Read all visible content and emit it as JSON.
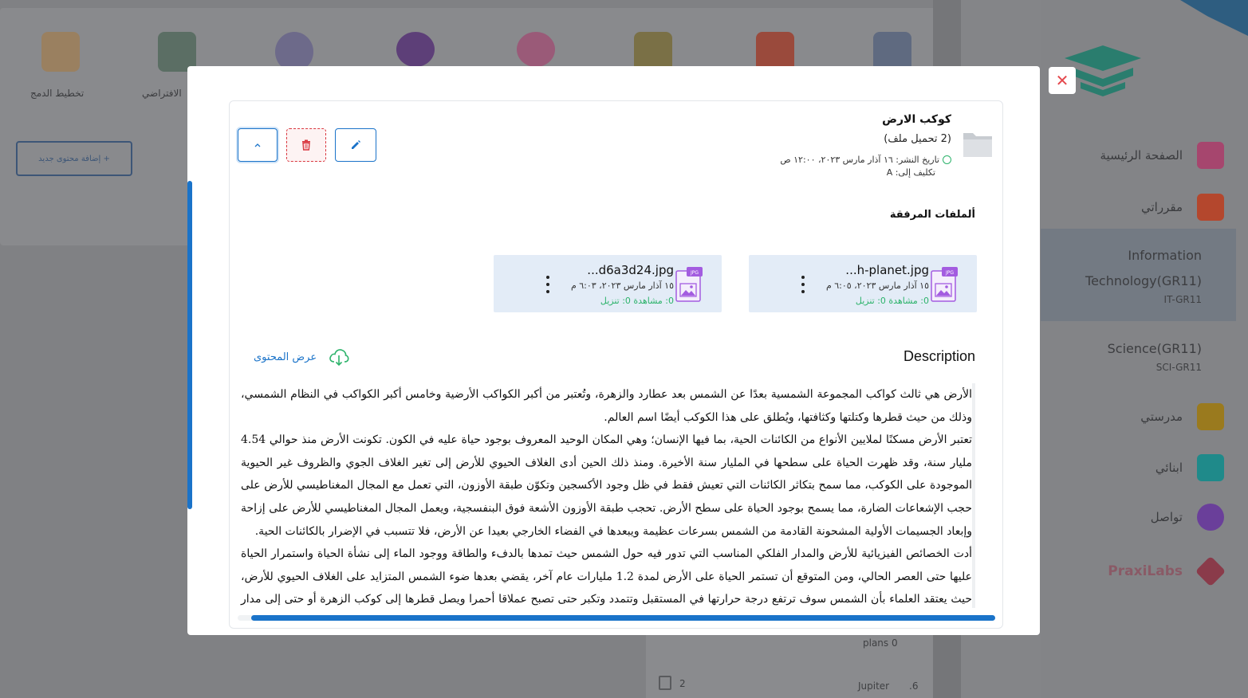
{
  "background": {
    "top_labels": [
      "تخطيط الدمج",
      "الافتراضي"
    ],
    "add_button": "+ إضافة محتوى جديد",
    "sidebar": {
      "items": [
        {
          "label": "الصفحة الرئيسية",
          "color": "#a6466e"
        },
        {
          "label": "مقرراتي",
          "color": "#b4472d"
        }
      ],
      "classes": [
        {
          "name": "Information Technology(GR11)",
          "code": "IT-GR11"
        },
        {
          "name": "Science(GR11)",
          "code": "SCI-GR11"
        }
      ],
      "more_items": [
        {
          "label": "مدرستي",
          "color": "#9a7a1e"
        },
        {
          "label": "ابنائي",
          "color": "#1f8a8a"
        },
        {
          "label": "تواصل",
          "color": "#6a3f9a"
        }
      ],
      "brand": "PraxiLabs"
    },
    "rows": {
      "row1": "plans 0",
      "row2_count": "2",
      "row2_name": "Jupiter",
      "row2_num": ".6"
    }
  },
  "modal": {
    "close_label": "✕",
    "lesson": {
      "title": "كوكب الارض",
      "subtitle": "(2 تحميل ملف)",
      "published": "تاريخ النشر: ١٦ آذار مارس ٢٠٢٣، ١٢:٠٠ ص",
      "assigned": "تكليف إلى: A"
    },
    "actions": {
      "edit": "edit",
      "delete": "delete",
      "collapse": "collapse"
    },
    "attachments_title": "ألملفات المرفقة",
    "files": [
      {
        "name": "...h-planet.jpg",
        "date": "١٥ آذار مارس ٢٠٢٣، ٦:٠٥ م",
        "stats": "0: مشاهدة 0: تنزيل"
      },
      {
        "name": "...d6a3d24.jpg",
        "date": "١٥ آذار مارس ٢٠٢٣، ٦:٠٣ م",
        "stats": "0: مشاهدة 0: تنزيل"
      }
    ],
    "description_title": "Description",
    "view_content": "عرض المحتوى",
    "description_paragraphs": [
      "الأرض هي ثالث كواكب المجموعة الشمسية بعدًا عن الشمس بعد عطارد والزهرة، وتُعتبر من أكبر الكواكب الأرضية وخامس أكبر الكواكب في النظام الشمسي، وذلك من حيث قطرها وكتلتها وكثافتها، ويُطلق على هذا الكوكب أيضًا اسم العالم.",
      "تعتبر الأرض مسكنًا لملايين الأنواع من الكائنات الحية، بما فيها الإنسان؛ وهي المكان الوحيد المعروف بوجود حياة عليه في الكون. تكونت الأرض منذ حوالي 4.54 مليار سنة، وقد ظهرت الحياة على سطحها في المليار سنة الأخيرة. ومنذ ذلك الحين أدى الغلاف الحيوي للأرض إلى تغير الغلاف الجوي والظروف غير الحيوية الموجودة على الكوكب، مما سمح بتكاثر الكائنات التي تعيش فقط في ظل وجود الأكسجين وتكوّن طبقة الأوزون، التي تعمل مع المجال المغناطيسي للأرض على حجب الإشعاعات الضارة، مما يسمح بوجود الحياة على سطح الأرض. تحجب طبقة الأوزون الأشعة فوق البنفسجية، ويعمل المجال المغناطيسي للأرض على إزاحة وإبعاد الجسيمات الأولية المشحونة القادمة من الشمس بسرعات عظيمة ويبعدها في الفضاء الخارجي بعيدا عن الأرض، فلا تتسبب في الإضرار بالكائنات الحية.",
      "أدت الخصائص الفيزيائية للأرض والمدار الفلكي المناسب التي تدور فيه حول الشمس حيث تمدها بالدفء والطاقة ووجود الماء إلى نشأة الحياة واستمرار الحياة عليها حتى العصر الحالي، ومن المتوقع أن تستمر الحياة على الأرض لمدة 1.2 مليارات عام آخر، يقضي بعدها ضوء الشمس المتزايد على الغلاف الحيوي للأرض، حيث يعتقد العلماء بأن الشمس سوف ترتفع درجة حرارتها في المستقبل وتتمدد وتكبر حتى تصبح عملاقا أحمرا ويصل قطرها إلى كوكب الزهرة أو حتى إلى مدار الأرض،"
    ]
  },
  "colors": {
    "accent": "#1a73c9",
    "danger": "#d9363e",
    "success": "#2db36b",
    "file_bg": "#e3ecf7"
  }
}
